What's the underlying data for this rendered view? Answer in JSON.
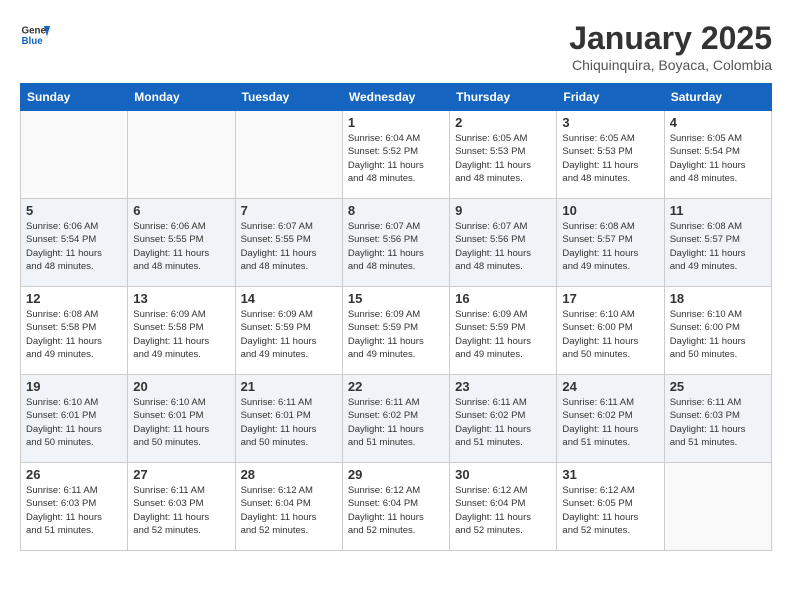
{
  "header": {
    "logo_general": "General",
    "logo_blue": "Blue",
    "title": "January 2025",
    "subtitle": "Chiquinquira, Boyaca, Colombia"
  },
  "days_of_week": [
    "Sunday",
    "Monday",
    "Tuesday",
    "Wednesday",
    "Thursday",
    "Friday",
    "Saturday"
  ],
  "weeks": [
    [
      {
        "day": "",
        "info": ""
      },
      {
        "day": "",
        "info": ""
      },
      {
        "day": "",
        "info": ""
      },
      {
        "day": "1",
        "info": "Sunrise: 6:04 AM\nSunset: 5:52 PM\nDaylight: 11 hours\nand 48 minutes."
      },
      {
        "day": "2",
        "info": "Sunrise: 6:05 AM\nSunset: 5:53 PM\nDaylight: 11 hours\nand 48 minutes."
      },
      {
        "day": "3",
        "info": "Sunrise: 6:05 AM\nSunset: 5:53 PM\nDaylight: 11 hours\nand 48 minutes."
      },
      {
        "day": "4",
        "info": "Sunrise: 6:05 AM\nSunset: 5:54 PM\nDaylight: 11 hours\nand 48 minutes."
      }
    ],
    [
      {
        "day": "5",
        "info": "Sunrise: 6:06 AM\nSunset: 5:54 PM\nDaylight: 11 hours\nand 48 minutes."
      },
      {
        "day": "6",
        "info": "Sunrise: 6:06 AM\nSunset: 5:55 PM\nDaylight: 11 hours\nand 48 minutes."
      },
      {
        "day": "7",
        "info": "Sunrise: 6:07 AM\nSunset: 5:55 PM\nDaylight: 11 hours\nand 48 minutes."
      },
      {
        "day": "8",
        "info": "Sunrise: 6:07 AM\nSunset: 5:56 PM\nDaylight: 11 hours\nand 48 minutes."
      },
      {
        "day": "9",
        "info": "Sunrise: 6:07 AM\nSunset: 5:56 PM\nDaylight: 11 hours\nand 48 minutes."
      },
      {
        "day": "10",
        "info": "Sunrise: 6:08 AM\nSunset: 5:57 PM\nDaylight: 11 hours\nand 49 minutes."
      },
      {
        "day": "11",
        "info": "Sunrise: 6:08 AM\nSunset: 5:57 PM\nDaylight: 11 hours\nand 49 minutes."
      }
    ],
    [
      {
        "day": "12",
        "info": "Sunrise: 6:08 AM\nSunset: 5:58 PM\nDaylight: 11 hours\nand 49 minutes."
      },
      {
        "day": "13",
        "info": "Sunrise: 6:09 AM\nSunset: 5:58 PM\nDaylight: 11 hours\nand 49 minutes."
      },
      {
        "day": "14",
        "info": "Sunrise: 6:09 AM\nSunset: 5:59 PM\nDaylight: 11 hours\nand 49 minutes."
      },
      {
        "day": "15",
        "info": "Sunrise: 6:09 AM\nSunset: 5:59 PM\nDaylight: 11 hours\nand 49 minutes."
      },
      {
        "day": "16",
        "info": "Sunrise: 6:09 AM\nSunset: 5:59 PM\nDaylight: 11 hours\nand 49 minutes."
      },
      {
        "day": "17",
        "info": "Sunrise: 6:10 AM\nSunset: 6:00 PM\nDaylight: 11 hours\nand 50 minutes."
      },
      {
        "day": "18",
        "info": "Sunrise: 6:10 AM\nSunset: 6:00 PM\nDaylight: 11 hours\nand 50 minutes."
      }
    ],
    [
      {
        "day": "19",
        "info": "Sunrise: 6:10 AM\nSunset: 6:01 PM\nDaylight: 11 hours\nand 50 minutes."
      },
      {
        "day": "20",
        "info": "Sunrise: 6:10 AM\nSunset: 6:01 PM\nDaylight: 11 hours\nand 50 minutes."
      },
      {
        "day": "21",
        "info": "Sunrise: 6:11 AM\nSunset: 6:01 PM\nDaylight: 11 hours\nand 50 minutes."
      },
      {
        "day": "22",
        "info": "Sunrise: 6:11 AM\nSunset: 6:02 PM\nDaylight: 11 hours\nand 51 minutes."
      },
      {
        "day": "23",
        "info": "Sunrise: 6:11 AM\nSunset: 6:02 PM\nDaylight: 11 hours\nand 51 minutes."
      },
      {
        "day": "24",
        "info": "Sunrise: 6:11 AM\nSunset: 6:02 PM\nDaylight: 11 hours\nand 51 minutes."
      },
      {
        "day": "25",
        "info": "Sunrise: 6:11 AM\nSunset: 6:03 PM\nDaylight: 11 hours\nand 51 minutes."
      }
    ],
    [
      {
        "day": "26",
        "info": "Sunrise: 6:11 AM\nSunset: 6:03 PM\nDaylight: 11 hours\nand 51 minutes."
      },
      {
        "day": "27",
        "info": "Sunrise: 6:11 AM\nSunset: 6:03 PM\nDaylight: 11 hours\nand 52 minutes."
      },
      {
        "day": "28",
        "info": "Sunrise: 6:12 AM\nSunset: 6:04 PM\nDaylight: 11 hours\nand 52 minutes."
      },
      {
        "day": "29",
        "info": "Sunrise: 6:12 AM\nSunset: 6:04 PM\nDaylight: 11 hours\nand 52 minutes."
      },
      {
        "day": "30",
        "info": "Sunrise: 6:12 AM\nSunset: 6:04 PM\nDaylight: 11 hours\nand 52 minutes."
      },
      {
        "day": "31",
        "info": "Sunrise: 6:12 AM\nSunset: 6:05 PM\nDaylight: 11 hours\nand 52 minutes."
      },
      {
        "day": "",
        "info": ""
      }
    ]
  ]
}
